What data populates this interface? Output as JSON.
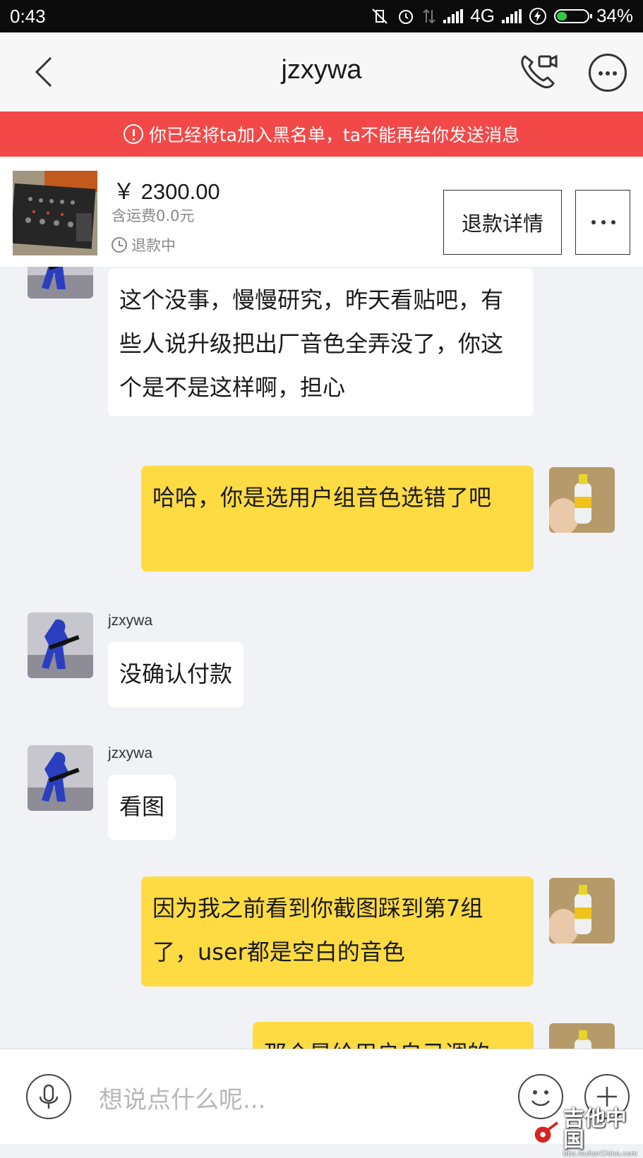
{
  "status_bar": {
    "time": "0:43",
    "network": "4G",
    "battery": "34%",
    "battery_level": 0.34
  },
  "header": {
    "title": "jzxywa",
    "back_icon": "chevron-left-icon",
    "call_icon": "phone-video-icon",
    "more_icon": "more-horizontal-icon"
  },
  "banner": {
    "text": "你已经将ta加入黑名单，ta不能再给你发送消息",
    "color": "#f34848"
  },
  "product": {
    "price": "￥ 2300.00",
    "shipping": "含运费0.0元",
    "status": "退款中",
    "refund_button": "退款详情"
  },
  "messages": [
    {
      "side": "left",
      "sender": "",
      "text": "这个没事，慢慢研究，昨天看贴吧，有些人说升级把出厂音色全弄没了，你这个是不是这样啊，担心"
    },
    {
      "side": "right",
      "text": "哈哈，你是选用户组音色选错了吧"
    },
    {
      "side": "left",
      "sender": "jzxywa",
      "text": "没确认付款"
    },
    {
      "side": "left",
      "sender": "jzxywa",
      "text": "看图"
    },
    {
      "side": "right",
      "text": "因为我之前看到你截图踩到第7组了，user都是空白的音色"
    },
    {
      "side": "right",
      "text": "那个是给用户自己调的"
    }
  ],
  "input": {
    "placeholder": "想说点什么呢...",
    "voice_icon": "microphone-icon",
    "emoji_icon": "smiley-icon",
    "add_icon": "plus-icon"
  },
  "watermark": {
    "title": "吉他中国",
    "url": "bbs.GuitarChina.com"
  },
  "colors": {
    "accent_yellow": "#fedb43",
    "banner_red": "#f34848",
    "background": "#f1f2f6"
  }
}
